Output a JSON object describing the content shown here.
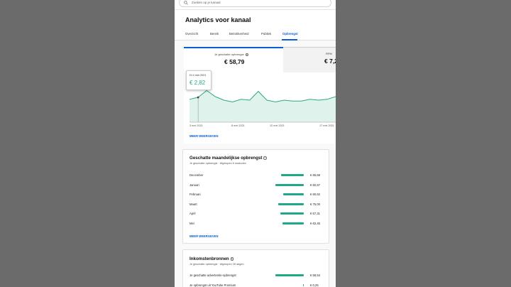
{
  "search": {
    "placeholder": "Zoeken op je kanaal"
  },
  "page_title": "Analytics voor kanaal",
  "tabs": [
    {
      "label": "Overzicht",
      "active": false
    },
    {
      "label": "Bereik",
      "active": false
    },
    {
      "label": "Betrokkenheid",
      "active": false
    },
    {
      "label": "Publiek",
      "active": false
    },
    {
      "label": "Opbrengst",
      "active": true
    }
  ],
  "metrics": [
    {
      "label": "Je geschatte opbrengst",
      "value": "€ 58,79",
      "selected": true
    },
    {
      "label": "RPM",
      "value": "€ 7,2",
      "selected": false
    }
  ],
  "tooltip": {
    "date": "Di 4 mei 2021",
    "value": "€ 2,82"
  },
  "chart_data": {
    "type": "area",
    "x_ticks": [
      "3 mei 2021",
      "8 mei 2021",
      "12 mei 2021",
      "17 mei 2021"
    ],
    "values": [
      2.6,
      2.82,
      3.6,
      2.9,
      2.5,
      2.3,
      2.6,
      2.5,
      3.5,
      2.5,
      2.3,
      2.5,
      2.4,
      2.4,
      2.6,
      2.5,
      2.6,
      2.9
    ],
    "ylim": [
      0,
      5
    ],
    "color": "#2ba888",
    "fill": "#dff2ec"
  },
  "more_link": "MEER WEERGEVEN",
  "monthly": {
    "title": "Geschatte maandelijkse opbrengst",
    "subtitle": "Je geschatte opbrengst · Afgelopen 6 maanden",
    "rows": [
      {
        "label": "December",
        "value": "€ 65,68",
        "amount": 65.68
      },
      {
        "label": "Januari",
        "value": "€ 82,57",
        "amount": 82.57
      },
      {
        "label": "Februari",
        "value": "€ 60,62",
        "amount": 60.62
      },
      {
        "label": "Maart",
        "value": "€ 75,00",
        "amount": 75.0
      },
      {
        "label": "April",
        "value": "€ 67,31",
        "amount": 67.31
      },
      {
        "label": "Mei",
        "value": "€ 62,45",
        "amount": 62.45
      }
    ],
    "more_link": "MEER WEERGEVEN"
  },
  "sources": {
    "title": "Inkomstenbronnen",
    "subtitle": "Je geschatte opbrengst · Afgelopen 28 dagen",
    "rows": [
      {
        "label": "Je geschatte advertentie-opbrengst",
        "value": "€ 58,54",
        "amount": 58.54
      },
      {
        "label": "Je opbrengst uit YouTube Premium",
        "value": "€ 0,25",
        "amount": 0.25
      }
    ]
  },
  "colors": {
    "accent": "#065fd4",
    "bar": "#1fa98a"
  }
}
